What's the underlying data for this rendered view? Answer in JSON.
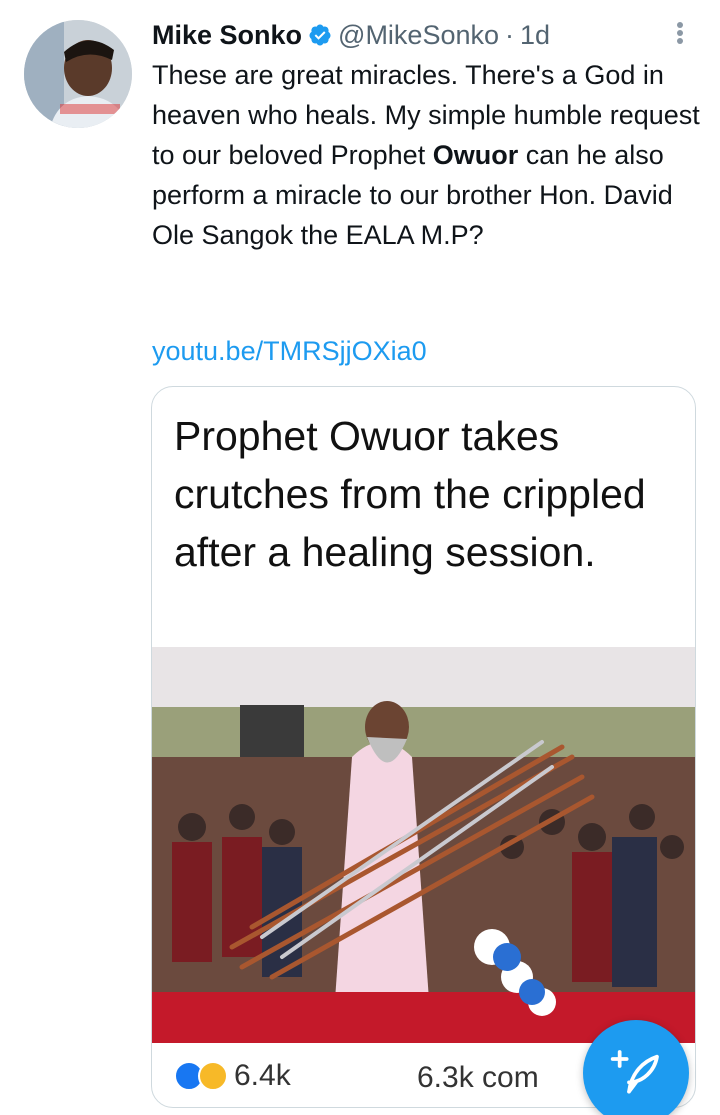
{
  "tweet": {
    "display_name": "Mike Sonko",
    "handle": "@MikeSonko",
    "separator": "·",
    "time": "1d",
    "text_part1": "These are great miracles. There's a God in heaven who heals. My simple humble request to our beloved Prophet ",
    "text_bold": "Owuor",
    "text_part2": " can he also perform a miracle  to our brother Hon. David Ole Sangok the EALA M.P?",
    "link": "youtu.be/TMRSjjOXia0"
  },
  "media": {
    "caption": "Prophet Owuor takes crutches from the crippled after a healing session.",
    "reactions_count": "6.4k",
    "comments_count": "6.3k com"
  },
  "icons": {
    "verified": "verified-badge-icon",
    "more": "more-vertical-icon",
    "compose": "compose-feather-icon",
    "like": "like-reaction-icon",
    "haha": "haha-reaction-icon"
  },
  "colors": {
    "accent": "#1d9bf0",
    "text": "#0f1419",
    "muted": "#536471"
  }
}
